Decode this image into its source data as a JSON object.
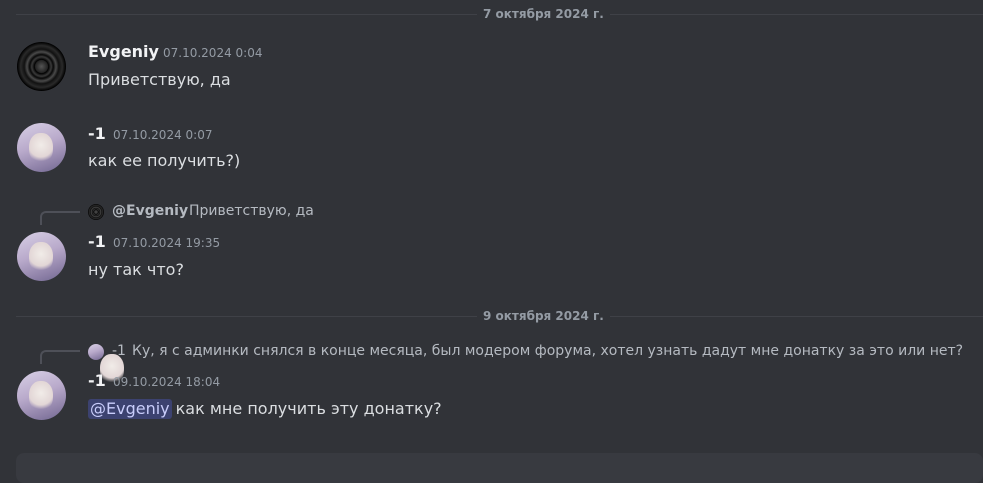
{
  "dividers": [
    {
      "label": "7 октября 2024 г."
    },
    {
      "label": "9 октября 2024 г."
    }
  ],
  "messages": [
    {
      "author": "Evgeniy",
      "time": "07.10.2024 0:04",
      "text": "Приветствую, да"
    },
    {
      "author": "-1",
      "time": "07.10.2024 0:07",
      "text": "как ее получить?)"
    },
    {
      "author": "-1",
      "time": "07.10.2024 19:35",
      "text": "ну так что?",
      "reply": {
        "name": "@Evgeniy",
        "text": "Приветствую, да"
      }
    },
    {
      "author": "-1",
      "time": "09.10.2024 18:04",
      "mention": "@Evgeniy",
      "text": "как мне получить эту донатку?",
      "reply": {
        "name": "-1",
        "text": "Ку, я с админки снялся в конце месяца, был модером форума, хотел узнать дадут мне донатку за это или нет?"
      }
    }
  ],
  "colors": {
    "background": "#313338",
    "mention_bg": "#3c4270",
    "mention_text": "#c9cdfb"
  }
}
